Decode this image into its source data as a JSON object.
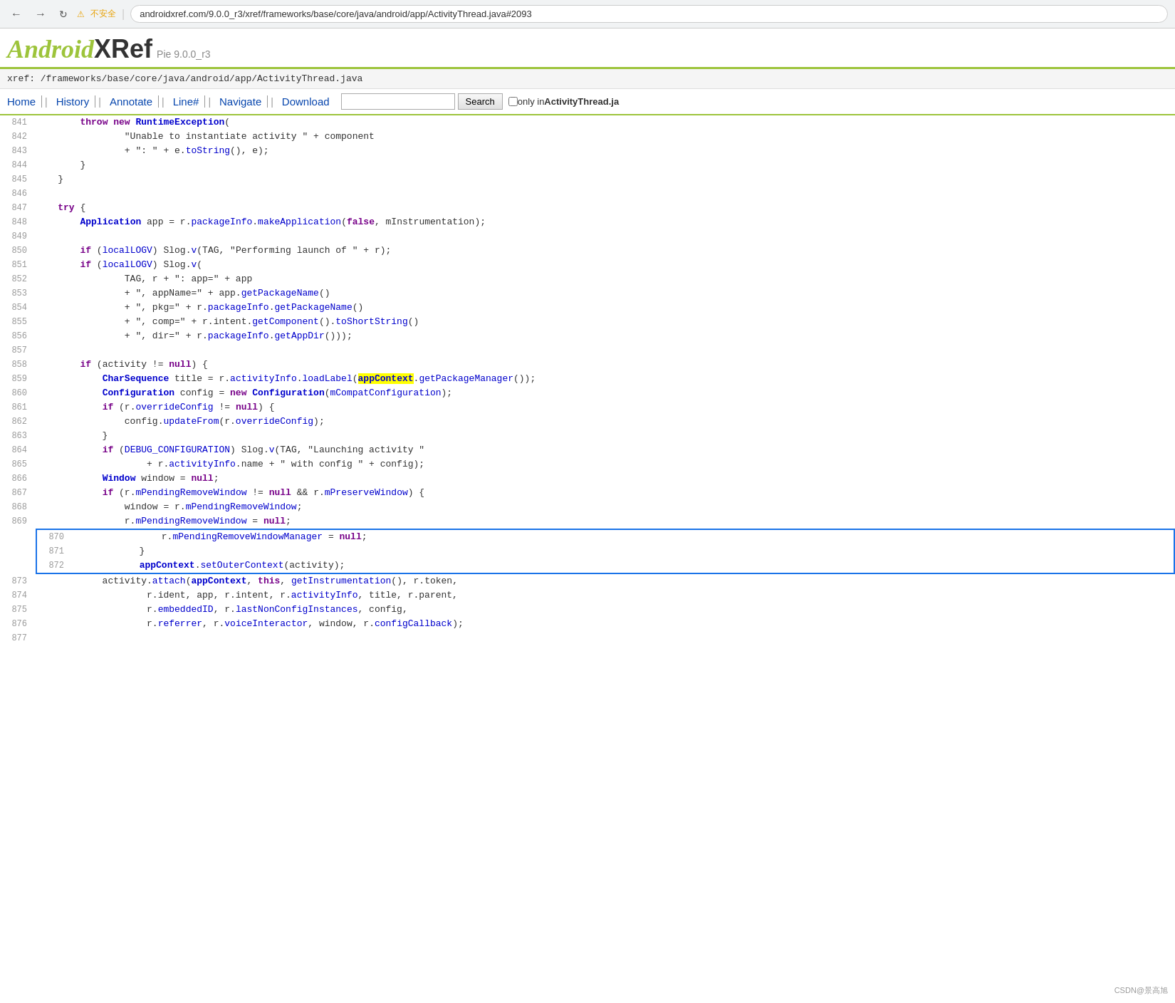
{
  "browser": {
    "url": "androidxref.com/9.0.0_r3/xref/frameworks/base/core/java/android/app/ActivityThread.java#2093",
    "security_warning": "不安全",
    "back_btn": "←",
    "forward_btn": "→",
    "reload_btn": "↻"
  },
  "header": {
    "logo_android": "Android",
    "logo_xref": "XRef",
    "version": "Pie 9.0.0_r3"
  },
  "breadcrumb": "xref: /frameworks/base/core/java/android/app/ActivityThread.java",
  "navbar": {
    "home": "Home",
    "history": "History",
    "annotate": "Annotate",
    "line": "Line#",
    "navigate": "Navigate",
    "download": "Download",
    "search_placeholder": "",
    "search_btn": "Search",
    "only_label": "only in",
    "only_filename": "ActivityThread.ja"
  },
  "lines": [
    {
      "num": "841",
      "tokens": [
        {
          "t": "        "
        },
        {
          "t": "throw",
          "c": "kw"
        },
        {
          "t": " "
        },
        {
          "t": "new",
          "c": "kw"
        },
        {
          "t": " "
        },
        {
          "t": "RuntimeException",
          "c": "cls"
        },
        {
          "t": "("
        }
      ]
    },
    {
      "num": "842",
      "tokens": [
        {
          "t": "                \"Unable to instantiate activity \" + component"
        }
      ]
    },
    {
      "num": "843",
      "tokens": [
        {
          "t": "                + \": \" + e."
        },
        {
          "t": "toString",
          "c": "method"
        },
        {
          "t": "(), e);"
        }
      ]
    },
    {
      "num": "844",
      "tokens": [
        {
          "t": "        }"
        }
      ]
    },
    {
      "num": "845",
      "tokens": [
        {
          "t": "    }"
        }
      ]
    },
    {
      "num": "846",
      "tokens": []
    },
    {
      "num": "847",
      "tokens": [
        {
          "t": "    "
        },
        {
          "t": "try",
          "c": "kw"
        },
        {
          "t": " {"
        }
      ]
    },
    {
      "num": "848",
      "tokens": [
        {
          "t": "        "
        },
        {
          "t": "Application",
          "c": "cls"
        },
        {
          "t": " app = r."
        },
        {
          "t": "packageInfo",
          "c": "var-blue"
        },
        {
          "t": "."
        },
        {
          "t": "makeApplication",
          "c": "method"
        },
        {
          "t": "("
        },
        {
          "t": "false",
          "c": "kw"
        },
        {
          "t": ", mInstrumentation);"
        }
      ]
    },
    {
      "num": "849",
      "tokens": []
    },
    {
      "num": "850",
      "tokens": [
        {
          "t": "        "
        },
        {
          "t": "if",
          "c": "kw"
        },
        {
          "t": " ("
        },
        {
          "t": "localLOGV",
          "c": "var-blue"
        },
        {
          "t": ") Slog."
        },
        {
          "t": "v",
          "c": "method"
        },
        {
          "t": "(TAG, \"Performing launch of \" + r);"
        }
      ]
    },
    {
      "num": "851",
      "tokens": [
        {
          "t": "        "
        },
        {
          "t": "if",
          "c": "kw"
        },
        {
          "t": " ("
        },
        {
          "t": "localLOGV",
          "c": "var-blue"
        },
        {
          "t": ") Slog."
        },
        {
          "t": "v",
          "c": "method"
        },
        {
          "t": "("
        }
      ]
    },
    {
      "num": "852",
      "tokens": [
        {
          "t": "                TAG, r + \": app=\" + app"
        }
      ]
    },
    {
      "num": "853",
      "tokens": [
        {
          "t": "                + \", appName=\" + app."
        },
        {
          "t": "getPackageName",
          "c": "method"
        },
        {
          "t": "()"
        }
      ]
    },
    {
      "num": "854",
      "tokens": [
        {
          "t": "                + \", pkg=\" + r."
        },
        {
          "t": "packageInfo",
          "c": "var-blue"
        },
        {
          "t": "."
        },
        {
          "t": "getPackageName",
          "c": "method"
        },
        {
          "t": "()"
        }
      ]
    },
    {
      "num": "855",
      "tokens": [
        {
          "t": "                + \", comp=\" + r.intent."
        },
        {
          "t": "getComponent",
          "c": "method"
        },
        {
          "t": "()."
        },
        {
          "t": "toShortString",
          "c": "method"
        },
        {
          "t": "()"
        }
      ]
    },
    {
      "num": "856",
      "tokens": [
        {
          "t": "                + \", dir=\" + r."
        },
        {
          "t": "packageInfo",
          "c": "var-blue"
        },
        {
          "t": "."
        },
        {
          "t": "getAppDir",
          "c": "method"
        },
        {
          "t": "()));"
        }
      ]
    },
    {
      "num": "857",
      "tokens": []
    },
    {
      "num": "858",
      "tokens": [
        {
          "t": "        "
        },
        {
          "t": "if",
          "c": "kw"
        },
        {
          "t": " (activity != "
        },
        {
          "t": "null",
          "c": "kw"
        },
        {
          "t": ") {"
        }
      ]
    },
    {
      "num": "859",
      "tokens": [
        {
          "t": "            "
        },
        {
          "t": "CharSequence",
          "c": "cls"
        },
        {
          "t": " title = r."
        },
        {
          "t": "activityInfo",
          "c": "var-blue"
        },
        {
          "t": "."
        },
        {
          "t": "loadLabel",
          "c": "method"
        },
        {
          "t": "("
        },
        {
          "t": "appContext",
          "c": "cls",
          "highlight": "yellow"
        },
        {
          "t": "."
        },
        {
          "t": "getPackageManager",
          "c": "method"
        },
        {
          "t": "());"
        }
      ]
    },
    {
      "num": "860",
      "tokens": [
        {
          "t": "            "
        },
        {
          "t": "Configuration",
          "c": "cls"
        },
        {
          "t": " config = "
        },
        {
          "t": "new",
          "c": "kw"
        },
        {
          "t": " "
        },
        {
          "t": "Configuration",
          "c": "cls"
        },
        {
          "t": "("
        },
        {
          "t": "mCompatConfiguration",
          "c": "var-blue"
        },
        {
          "t": ");"
        }
      ]
    },
    {
      "num": "861",
      "tokens": [
        {
          "t": "            "
        },
        {
          "t": "if",
          "c": "kw"
        },
        {
          "t": " (r."
        },
        {
          "t": "overrideConfig",
          "c": "var-blue"
        },
        {
          "t": " != "
        },
        {
          "t": "null",
          "c": "kw"
        },
        {
          "t": ") {"
        }
      ]
    },
    {
      "num": "862",
      "tokens": [
        {
          "t": "                config."
        },
        {
          "t": "updateFrom",
          "c": "method"
        },
        {
          "t": "(r."
        },
        {
          "t": "overrideConfig",
          "c": "var-blue"
        },
        {
          "t": ");"
        }
      ]
    },
    {
      "num": "863",
      "tokens": [
        {
          "t": "            }"
        }
      ]
    },
    {
      "num": "864",
      "tokens": [
        {
          "t": "            "
        },
        {
          "t": "if",
          "c": "kw"
        },
        {
          "t": " ("
        },
        {
          "t": "DEBUG_CONFIGURATION",
          "c": "var-blue"
        },
        {
          "t": ") Slog."
        },
        {
          "t": "v",
          "c": "method"
        },
        {
          "t": "(TAG, \"Launching activity \""
        }
      ]
    },
    {
      "num": "865",
      "tokens": [
        {
          "t": "                    + r."
        },
        {
          "t": "activityInfo",
          "c": "var-blue"
        },
        {
          "t": ".name + \" with config \" + config);"
        }
      ]
    },
    {
      "num": "866",
      "tokens": [
        {
          "t": "            "
        },
        {
          "t": "Window",
          "c": "cls"
        },
        {
          "t": " window = "
        },
        {
          "t": "null",
          "c": "kw"
        },
        {
          "t": ";"
        }
      ]
    },
    {
      "num": "867",
      "tokens": [
        {
          "t": "            "
        },
        {
          "t": "if",
          "c": "kw"
        },
        {
          "t": " (r."
        },
        {
          "t": "mPendingRemoveWindow",
          "c": "var-blue"
        },
        {
          "t": " != "
        },
        {
          "t": "null",
          "c": "kw"
        },
        {
          "t": " && r."
        },
        {
          "t": "mPreserveWindow",
          "c": "var-blue"
        },
        {
          "t": ") {"
        }
      ]
    },
    {
      "num": "868",
      "tokens": [
        {
          "t": "                window = r."
        },
        {
          "t": "mPendingRemoveWindow",
          "c": "var-blue"
        },
        {
          "t": ";"
        }
      ]
    },
    {
      "num": "869",
      "tokens": [
        {
          "t": "                r."
        },
        {
          "t": "mPendingRemoveWindow",
          "c": "var-blue"
        },
        {
          "t": " = "
        },
        {
          "t": "null",
          "c": "kw"
        },
        {
          "t": ";"
        }
      ]
    },
    {
      "num": "870",
      "tokens": [
        {
          "t": "                r."
        },
        {
          "t": "mPendingRemoveWindowManager",
          "c": "var-blue"
        },
        {
          "t": " = "
        },
        {
          "t": "null",
          "c": "kw"
        },
        {
          "t": ";"
        }
      ],
      "boxStart": true
    },
    {
      "num": "871",
      "tokens": [
        {
          "t": "            }"
        }
      ],
      "boxEnd": true,
      "boxCont": true
    },
    {
      "num": "872",
      "tokens": [
        {
          "t": "            "
        },
        {
          "t": "appContext",
          "c": "cls"
        },
        {
          "t": "."
        },
        {
          "t": "setOuterContext",
          "c": "method"
        },
        {
          "t": "(activity);"
        }
      ],
      "boxCont": true,
      "boxEnd2": true
    },
    {
      "num": "873",
      "tokens": [
        {
          "t": "            activity."
        },
        {
          "t": "attach",
          "c": "method"
        },
        {
          "t": "("
        },
        {
          "t": "appContext",
          "c": "cls"
        },
        {
          "t": ", "
        },
        {
          "t": "this",
          "c": "kw"
        },
        {
          "t": ", "
        },
        {
          "t": "getInstrumentation",
          "c": "method"
        },
        {
          "t": "(), r.token,"
        }
      ]
    },
    {
      "num": "874",
      "tokens": [
        {
          "t": "                    r.ident, app, r.intent, r."
        },
        {
          "t": "activityInfo",
          "c": "var-blue"
        },
        {
          "t": ", title, r.parent,"
        }
      ]
    },
    {
      "num": "875",
      "tokens": [
        {
          "t": "                    r."
        },
        {
          "t": "embeddedID",
          "c": "var-blue"
        },
        {
          "t": ", r."
        },
        {
          "t": "lastNonConfigInstances",
          "c": "var-blue"
        },
        {
          "t": ", config,"
        }
      ]
    },
    {
      "num": "876",
      "tokens": [
        {
          "t": "                    r."
        },
        {
          "t": "referrer",
          "c": "var-blue"
        },
        {
          "t": ", r."
        },
        {
          "t": "voiceInteractor",
          "c": "var-blue"
        },
        {
          "t": ", window, r."
        },
        {
          "t": "configCallback",
          "c": "var-blue"
        },
        {
          "t": ");"
        }
      ]
    },
    {
      "num": "877",
      "tokens": []
    }
  ],
  "watermark": "CSDN@景高旭"
}
